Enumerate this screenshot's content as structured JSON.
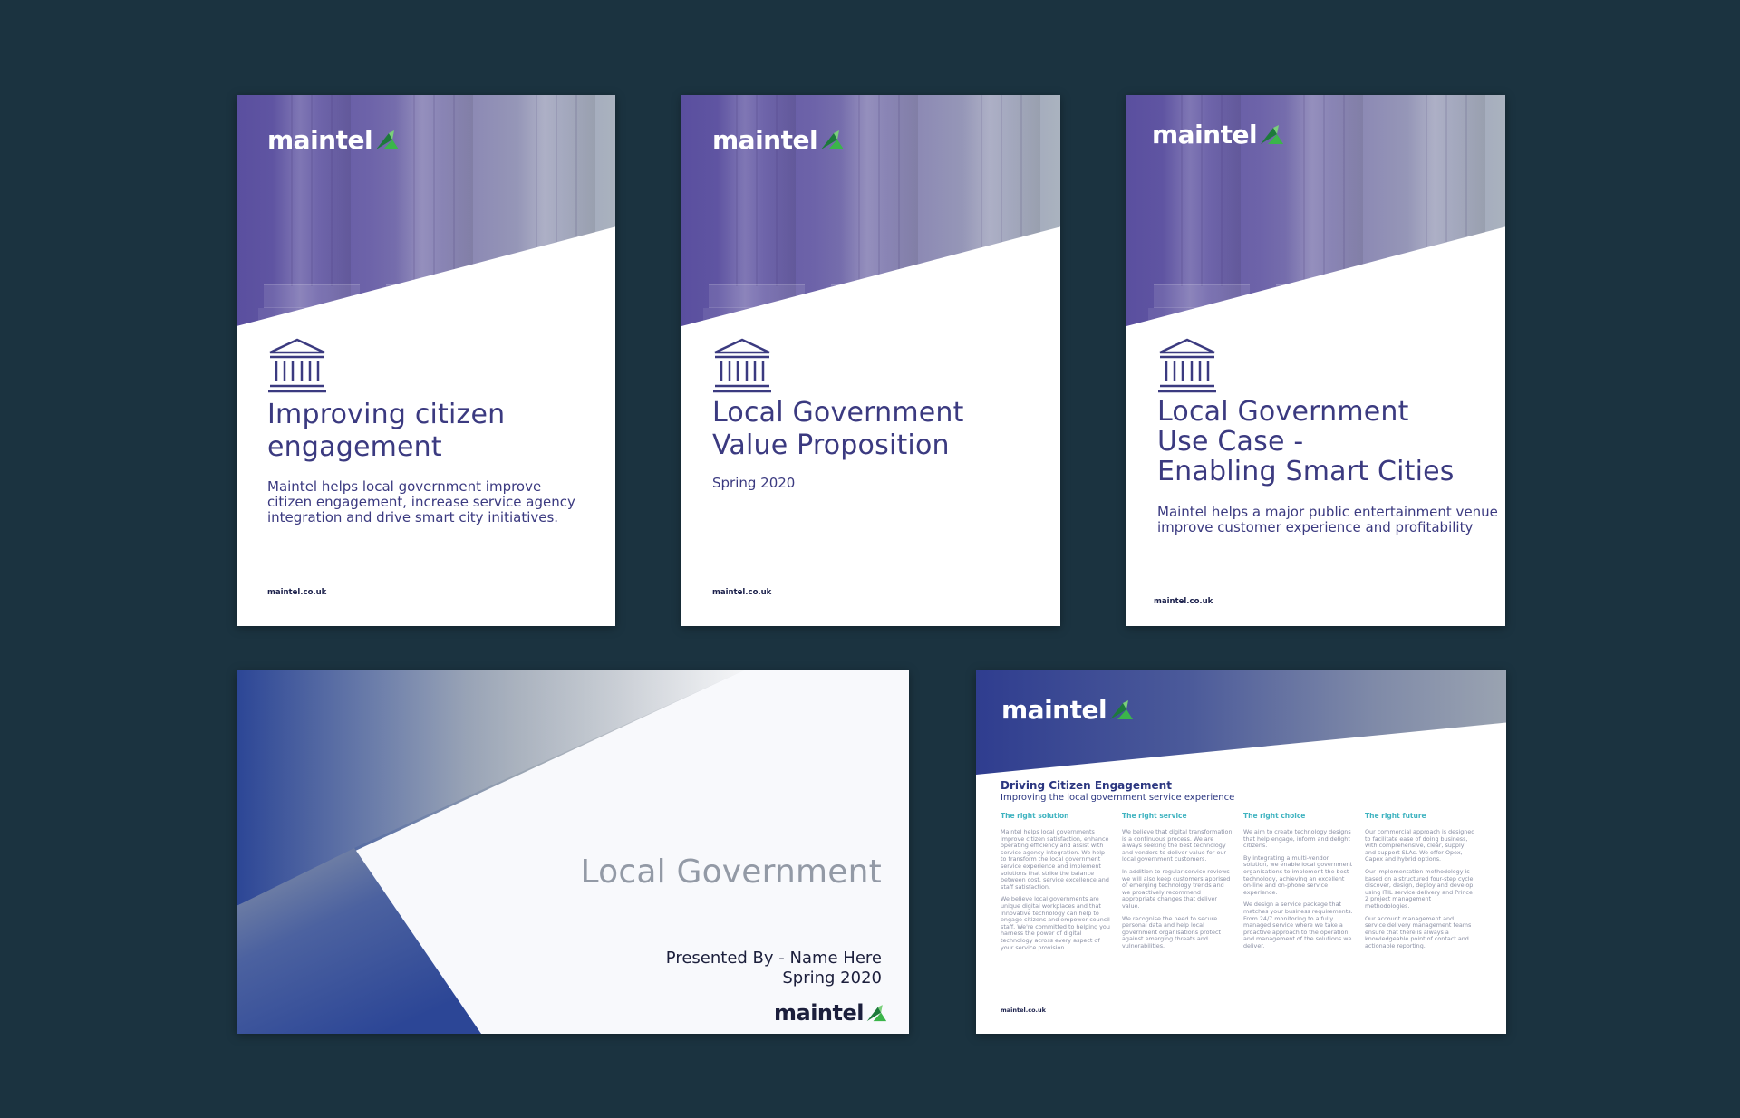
{
  "brand": {
    "name": "maintel",
    "url": "maintel.co.uk"
  },
  "colors": {
    "background": "#1b3340",
    "brand_navy": "#3b3a80",
    "teal": "#3fb3c0",
    "accent_green": "#3bb54a"
  },
  "covers": [
    {
      "title_lines": [
        "Improving citizen",
        "engagement"
      ],
      "subtitle_lines": [
        "Maintel helps local government improve",
        "citizen engagement, increase service agency",
        "integration and drive smart city initiatives."
      ],
      "icon": "government-building-icon"
    },
    {
      "title_lines": [
        "Local Government",
        "Value Proposition"
      ],
      "subtitle_lines": [
        "Spring 2020"
      ],
      "icon": "government-building-icon"
    },
    {
      "title_lines": [
        "Local Government",
        "Use Case -",
        "Enabling Smart Cities"
      ],
      "subtitle_lines": [
        "Maintel helps a major public entertainment venue",
        "improve customer experience and profitability"
      ],
      "icon": "government-building-icon"
    }
  ],
  "slide": {
    "title": "Local Government",
    "presented_by": "Presented By - Name Here",
    "date": "Spring 2020"
  },
  "landscape_doc": {
    "heading": "Driving Citizen Engagement",
    "subheading": "Improving the local government service experience",
    "columns": [
      {
        "heading": "The right solution",
        "paragraphs": [
          "Maintel helps local governments improve citizen satisfaction, enhance operating efficiency and assist with service agency integration. We help to transform the local government service experience and implement solutions that strike the balance between cost, service excellence and staff satisfaction.",
          "We believe local governments are unique digital workplaces and that innovative technology can help to engage citizens and empower council staff. We're committed to helping you harness the power of digital technology across every aspect of your service provision."
        ]
      },
      {
        "heading": "The right service",
        "paragraphs": [
          "We believe that digital transformation is a continuous process. We are always seeking the best technology and vendors to deliver value for our local government customers.",
          "In addition to regular service reviews we will also keep customers apprised of emerging technology trends and we proactively recommend appropriate changes that deliver value.",
          "We recognise the need to secure personal data and help local government organisations protect against emerging threats and vulnerabilities."
        ]
      },
      {
        "heading": "The right choice",
        "paragraphs": [
          "We aim to create technology designs that help engage, inform and delight citizens.",
          "By integrating a multi-vendor solution, we enable local government organisations to implement the best technology, achieving an excellent on-line and on-phone service experience.",
          "We design a service package that matches your business requirements. From 24/7 monitoring to a fully managed service where we take a proactive approach to the operation and management of the solutions we deliver."
        ]
      },
      {
        "heading": "The right future",
        "paragraphs": [
          "Our commercial approach is designed to facilitate ease of doing business, with comprehensive, clear, supply and support SLAs. We offer Opex, Capex and hybrid options.",
          "Our implementation methodology is based on a structured four-step cycle: discover, design, deploy and develop using ITIL service delivery and Prince 2 project management methodologies.",
          "Our account management and service delivery management teams ensure that there is always a knowledgeable point of contact and actionable reporting."
        ]
      }
    ]
  }
}
